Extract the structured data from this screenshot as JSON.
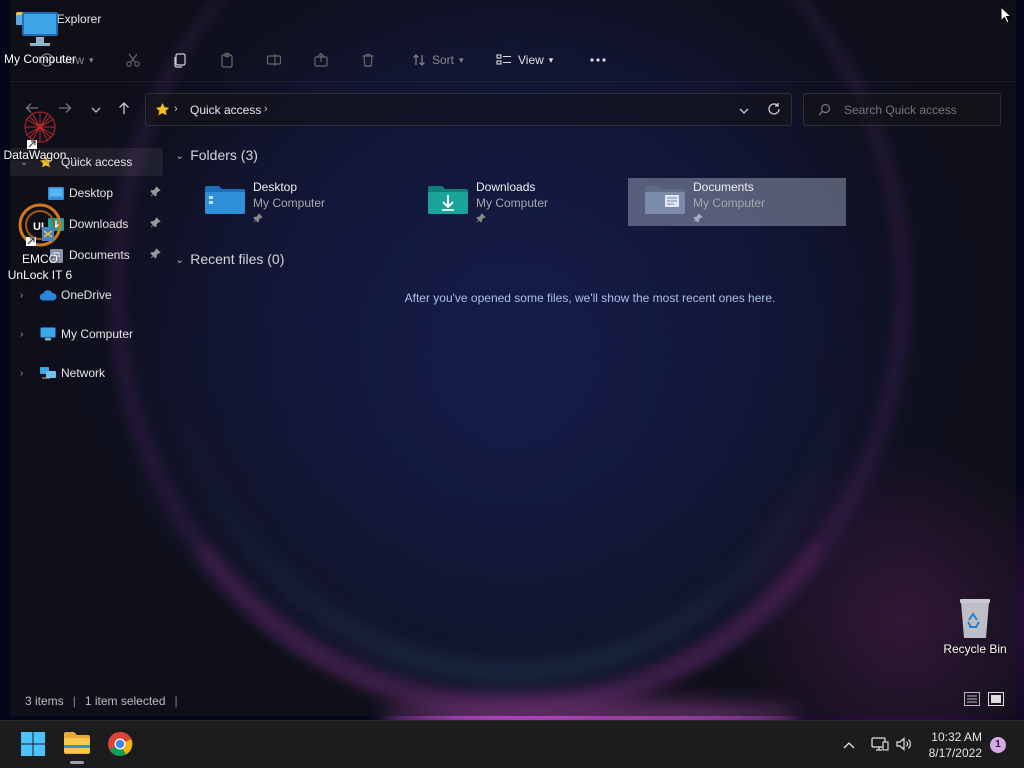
{
  "window": {
    "title": "File Explorer"
  },
  "toolbar": {
    "new_label": "New",
    "sort_label": "Sort",
    "view_label": "View"
  },
  "address": {
    "crumb": "Quick access"
  },
  "search": {
    "placeholder": "Search Quick access"
  },
  "nav": {
    "items": [
      {
        "label": "Quick access"
      },
      {
        "label": "Desktop"
      },
      {
        "label": "Downloads"
      },
      {
        "label": "Documents"
      },
      {
        "label": "OneDrive"
      },
      {
        "label": "My Computer"
      },
      {
        "label": "Network"
      }
    ]
  },
  "content": {
    "folders_header": "Folders (3)",
    "recent_header": "Recent files (0)",
    "folders": [
      {
        "name": "Desktop",
        "location": "My Computer"
      },
      {
        "name": "Downloads",
        "location": "My Computer"
      },
      {
        "name": "Documents",
        "location": "My Computer"
      }
    ],
    "empty_message": "After you've opened some files, we'll show the most recent ones here."
  },
  "status": {
    "items": "3 items",
    "selected": "1 item selected"
  },
  "desktop": {
    "icons": [
      {
        "label": "My Computer"
      },
      {
        "label": "DataWagon..."
      },
      {
        "label": "EMCO UnLock IT 6"
      },
      {
        "label": "Recycle Bin"
      }
    ],
    "unlock_badge": "UL"
  },
  "taskbar": {
    "time": "10:32 AM",
    "date": "8/17/2022",
    "notification_count": "1"
  },
  "colors": {
    "accent": "#4cc2ff",
    "folder_blue": "#2f8fd8",
    "folder_teal": "#1ba39c",
    "star": "#f3c11b"
  }
}
